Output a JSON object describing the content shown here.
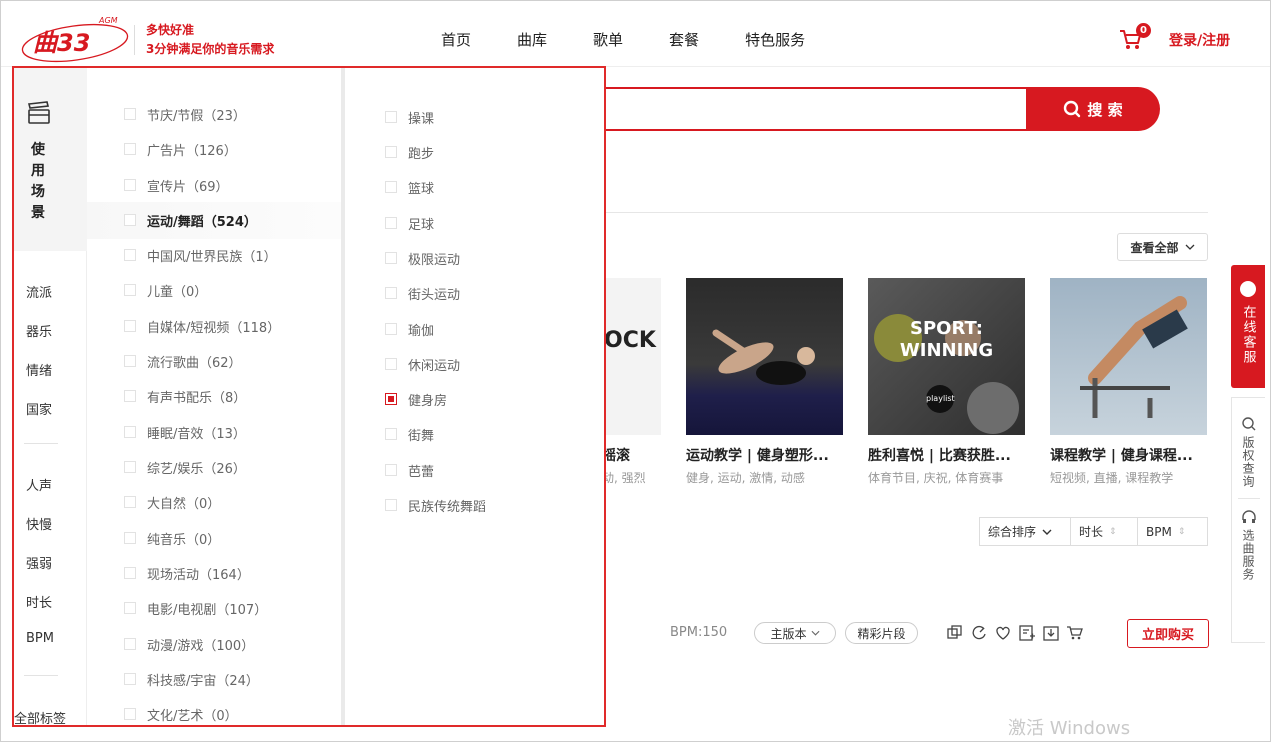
{
  "brand": {
    "logo_text": "曲33",
    "logo_badge": "AGM",
    "slogan_line1": "多快好准",
    "slogan_line2": "3分钟满足你的音乐需求",
    "accent": "#d71920"
  },
  "nav": [
    "首页",
    "曲库",
    "歌单",
    "套餐",
    "特色服务"
  ],
  "cart_count": "0",
  "login_label": "登录/注册",
  "search": {
    "button_label": "搜 索",
    "placeholder": ""
  },
  "view_all_label": "查看全部",
  "cards": [
    {
      "title": "摇滚",
      "tags": "动, 强烈",
      "thumb_text": "OCK"
    },
    {
      "title": "运动教学 | 健身塑形...",
      "tags": "健身, 运动, 激情, 动感"
    },
    {
      "title": "胜利喜悦 | 比赛获胜...",
      "tags": "体育节目, 庆祝, 体育赛事",
      "thumb_text1": "SPORT:",
      "thumb_text2": "WINNING",
      "thumb_text3": "playlist"
    },
    {
      "title": "课程教学 | 健身课程...",
      "tags": "短视频, 直播, 课程教学"
    }
  ],
  "sort": {
    "overall": "综合排序",
    "duration": "时长",
    "bpm": "BPM"
  },
  "track": {
    "bpm_label": "BPM:150",
    "version_label": "主版本",
    "highlight_label": "精彩片段",
    "buy_label": "立即购买"
  },
  "watermark": "激活 Windows",
  "side": {
    "service_label": "在线客服",
    "copyright_label": "版权查询",
    "pick_label": "选曲服务"
  },
  "filter": {
    "active_category": "使用场景",
    "categories_group1": [
      "流派",
      "器乐",
      "情绪",
      "国家"
    ],
    "categories_group2": [
      "人声",
      "快慢",
      "强弱",
      "时长",
      "BPM"
    ],
    "all_tags_label": "全部标签",
    "options": [
      "节庆/节假（23）",
      "广告片（126）",
      "宣传片（69）",
      "运动/舞蹈（524）",
      "中国风/世界民族（1）",
      "儿童（0）",
      "自媒体/短视频（118）",
      "流行歌曲（62）",
      "有声书配乐（8）",
      "睡眠/音效（13）",
      "综艺/娱乐（26）",
      "大自然（0）",
      "纯音乐（0）",
      "现场活动（164）",
      "电影/电视剧（107）",
      "动漫/游戏（100）",
      "科技感/宇宙（24）",
      "文化/艺术（0）"
    ],
    "active_option_index": 3,
    "sub_options": [
      "操课",
      "跑步",
      "篮球",
      "足球",
      "极限运动",
      "街头运动",
      "瑜伽",
      "休闲运动",
      "健身房",
      "街舞",
      "芭蕾",
      "民族传统舞蹈"
    ],
    "checked_sub_index": 8
  }
}
